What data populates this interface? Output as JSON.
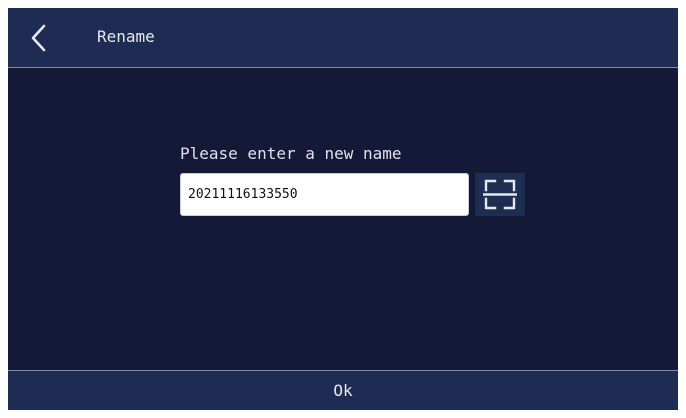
{
  "header": {
    "back_icon": "chevron-left-icon",
    "title": "Rename"
  },
  "form": {
    "prompt": "Please enter a new name",
    "name_value": "20211116133550",
    "scan_icon": "scan-frame-icon"
  },
  "footer": {
    "ok_label": "Ok"
  },
  "colors": {
    "background": "#141937",
    "bar": "#1e2b52",
    "divider": "#7f8cab",
    "text": "#e6e8ef"
  }
}
